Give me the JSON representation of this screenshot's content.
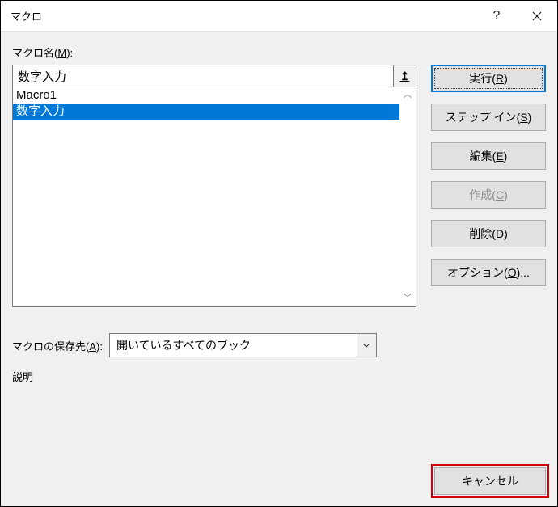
{
  "title": "マクロ",
  "macroNameLabelPrefix": "マクロ名(",
  "macroNameHotkey": "M",
  "labelSuffix": "):",
  "macroNameValue": "数字入力",
  "listItems": [
    "Macro1",
    "数字入力"
  ],
  "selectedIndex": 1,
  "buttons": {
    "run": {
      "pre": "実行(",
      "hk": "R",
      "post": ")"
    },
    "stepIn": {
      "pre": "ステップ イン(",
      "hk": "S",
      "post": ")"
    },
    "edit": {
      "pre": "編集(",
      "hk": "E",
      "post": ")"
    },
    "create": {
      "pre": "作成(",
      "hk": "C",
      "post": ")"
    },
    "delete": {
      "pre": "削除(",
      "hk": "D",
      "post": ")"
    },
    "options": {
      "pre": "オプション(",
      "hk": "O",
      "post": ")..."
    }
  },
  "storageLabelPrefix": "マクロの保存先(",
  "storageHotkey": "A",
  "storageValue": "開いているすべてのブック",
  "descLabel": "説明",
  "cancelLabel": "キャンセル",
  "runArrowGlyph": "↥"
}
